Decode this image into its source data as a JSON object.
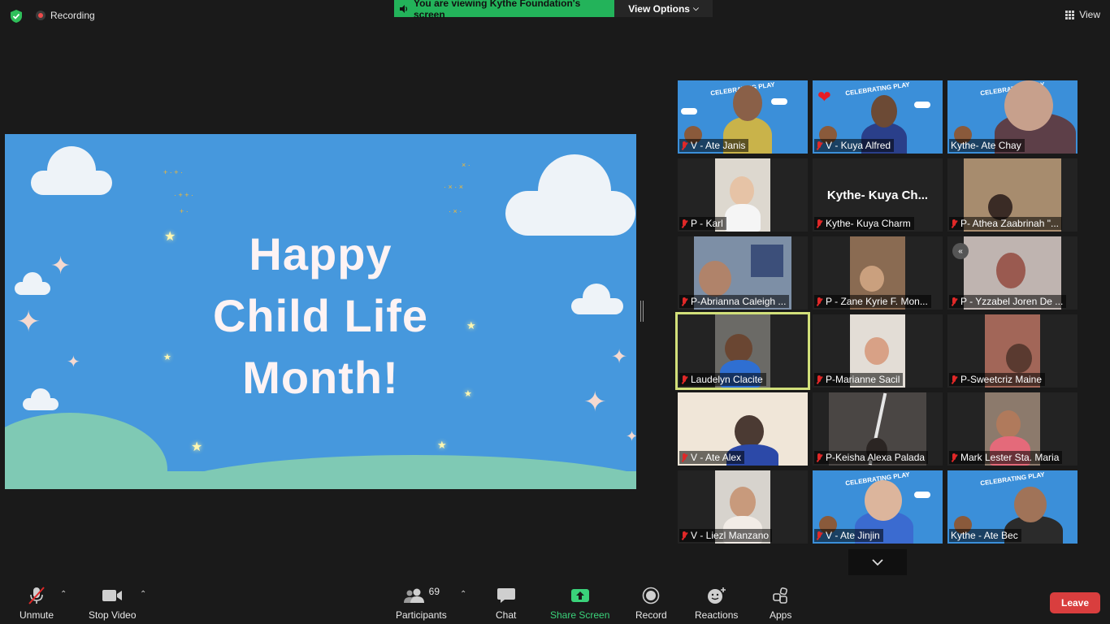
{
  "top": {
    "recording_label": "Recording",
    "viewing_banner": "You are viewing Kythe Foundation's screen",
    "view_options_label": "View Options",
    "view_label": "View"
  },
  "shared_screen": {
    "line1": "Happy",
    "line2": "Child Life",
    "line3": "Month!"
  },
  "gallery": {
    "tiles": [
      {
        "name": "V - Ate Janis",
        "muted": true
      },
      {
        "name": "V - Kuya Alfred",
        "muted": true
      },
      {
        "name": "Kythe- Ate Chay",
        "muted": false
      },
      {
        "name": "P - Karl",
        "muted": true
      },
      {
        "name": "Kythe- Kuya Charm",
        "muted": true,
        "display_name": "Kythe- Kuya Ch..."
      },
      {
        "name": "P- Athea Zaabrinah \"...",
        "muted": true
      },
      {
        "name": "P-Abrianna Caleigh ...",
        "muted": true
      },
      {
        "name": "P - Zane Kyrie F. Mon...",
        "muted": true
      },
      {
        "name": "P - Yzzabel Joren De ...",
        "muted": true
      },
      {
        "name": "Laudelyn Clacite",
        "muted": true
      },
      {
        "name": "P-Marianne Sacil",
        "muted": true
      },
      {
        "name": "P-Sweetcriz Maine",
        "muted": true
      },
      {
        "name": "V - Ate Alex",
        "muted": true
      },
      {
        "name": "P-Keisha Alexa Palada",
        "muted": true
      },
      {
        "name": "Mark Lester Sta. Maria",
        "muted": true
      },
      {
        "name": "V - Liezl Manzano",
        "muted": true
      },
      {
        "name": "V - Ate Jinjin",
        "muted": true
      },
      {
        "name": "Kythe - Ate Bec",
        "muted": false
      }
    ],
    "play_banner_text": "CELEBRATING PLAY"
  },
  "toolbar": {
    "unmute": "Unmute",
    "stop_video": "Stop Video",
    "participants": "Participants",
    "participants_count": "69",
    "chat": "Chat",
    "share_screen": "Share Screen",
    "record": "Record",
    "reactions": "Reactions",
    "apps": "Apps",
    "leave": "Leave"
  },
  "colors": {
    "banner_green": "#23b35a",
    "leave_red": "#d93e3e",
    "share_green": "#3ad27a",
    "active_speaker": "#d2e07a",
    "muted_red": "#e02828"
  }
}
